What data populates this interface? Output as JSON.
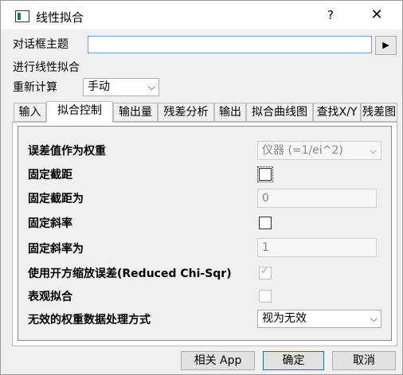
{
  "window": {
    "title": "线性拟合",
    "help": "?",
    "close": "✕",
    "icon": "app-window-icon"
  },
  "top": {
    "theme_label": "对话框主题",
    "theme_value": "",
    "play_icon": "▶",
    "fit_label": "进行线性拟合",
    "recalc_label": "重新计算",
    "recalc_value": "手动"
  },
  "tabs": [
    {
      "label": "输入"
    },
    {
      "label": "拟合控制"
    },
    {
      "label": "输出量"
    },
    {
      "label": "残差分析"
    },
    {
      "label": "输出"
    },
    {
      "label": "拟合曲线图"
    },
    {
      "label": "查找X/Y"
    },
    {
      "label": "残差图"
    }
  ],
  "active_tab": "拟合控制",
  "fit_control": {
    "weight_label": "误差值作为权重",
    "weight_value": "仪器  (=1/ei^2)",
    "fix_intercept_label": "固定截距",
    "fix_intercept_checked": false,
    "fix_intercept_at_label": "固定截距为",
    "fix_intercept_at_value": "0",
    "fix_slope_label": "固定斜率",
    "fix_slope_checked": false,
    "fix_slope_at_label": "固定斜率为",
    "fix_slope_at_value": "1",
    "reduced_chisqr_label": "使用开方缩放误差(Reduced Chi-Sqr)",
    "reduced_chisqr_checked": true,
    "apparent_fit_label": "表观拟合",
    "apparent_fit_checked": false,
    "invalid_weight_label": "无效的权重数据处理方式",
    "invalid_weight_value": "视为无效"
  },
  "buttons": {
    "related_app": "相关 App",
    "ok": "确定",
    "cancel": "取消"
  }
}
